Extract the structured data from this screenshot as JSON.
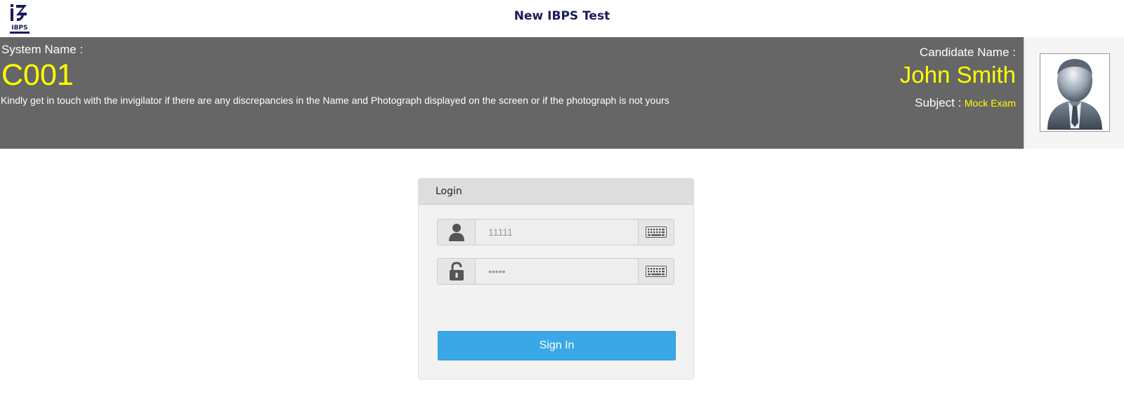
{
  "header": {
    "title": "New IBPS Test",
    "logo_text": "IBPS"
  },
  "banner": {
    "system_name_label": "System Name :",
    "system_name_value": "C001",
    "notice": "Kindly get in touch with the invigilator if there are any discrepancies in the Name and Photograph displayed on the screen or if the photograph is not yours",
    "candidate_name_label": "Candidate Name :",
    "candidate_name_value": "John Smith",
    "subject_label": "Subject :",
    "subject_value": "Mock Exam"
  },
  "login": {
    "title": "Login",
    "username_placeholder": "11111",
    "password_placeholder": "•••••",
    "signin_label": "Sign In"
  },
  "icons": {
    "user": "user-icon",
    "lock": "lock-icon",
    "keyboard": "keyboard-icon",
    "avatar": "avatar-icon"
  },
  "colors": {
    "banner_bg": "#666666",
    "highlight": "#ffff00",
    "title": "#1a1a5e",
    "signin_bg": "#3aa8e6"
  }
}
